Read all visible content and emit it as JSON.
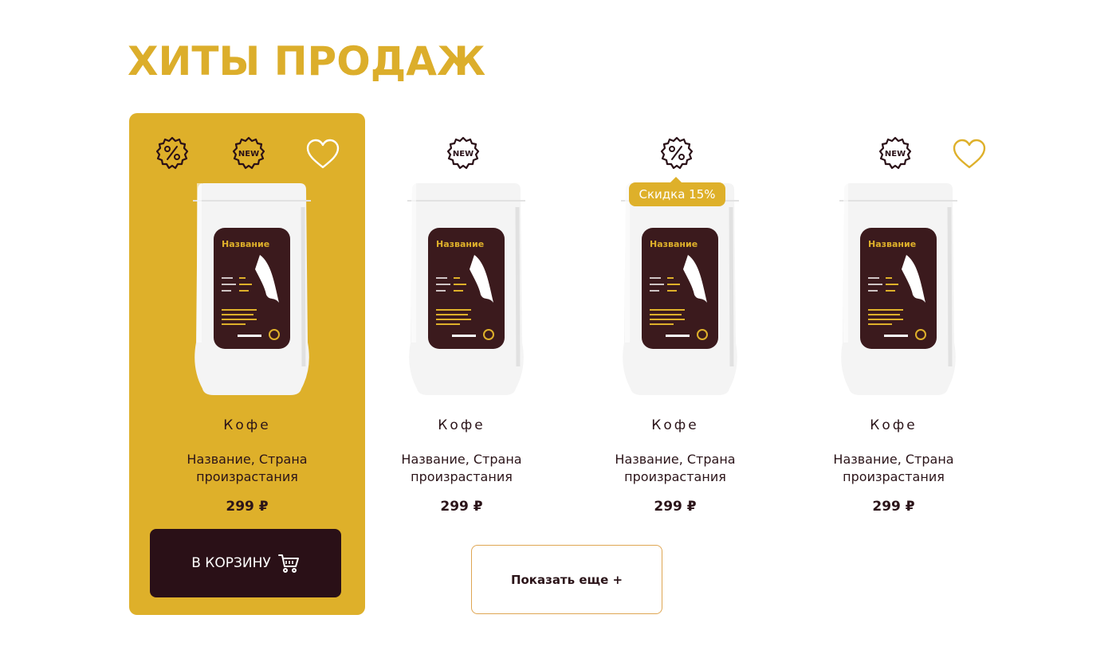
{
  "section": {
    "title": "ХИТЫ ПРОДАЖ"
  },
  "products": [
    {
      "name": "Кофе",
      "desc_line1": "Название, Страна",
      "desc_line2": "произрастания",
      "price": "299 ₽",
      "label_title": "Название",
      "badges": [
        "percent-badge",
        "new-badge",
        "heart"
      ]
    },
    {
      "name": "Кофе",
      "desc_line1": "Название, Страна",
      "desc_line2": "произрастания",
      "price": "299 ₽",
      "label_title": "Название",
      "badges": [
        "new-badge"
      ]
    },
    {
      "name": "Кофе",
      "desc_line1": "Название, Страна",
      "desc_line2": "произрастания",
      "price": "299 ₽",
      "label_title": "Название",
      "badges": [
        "percent-badge"
      ]
    },
    {
      "name": "Кофе",
      "desc_line1": "Название, Страна",
      "desc_line2": "произрастания",
      "price": "299 ₽",
      "label_title": "Название",
      "badges": [
        "new-badge",
        "heart"
      ]
    }
  ],
  "cart_button": {
    "label": "В КОРЗИНУ"
  },
  "discount_tooltip": {
    "text": "Скидка 15%"
  },
  "more_button": {
    "label": "Показать еще +"
  },
  "colors": {
    "accent": "#deb02a",
    "dark": "#2a1017",
    "text": "#2b1419",
    "outline": "#dfa653",
    "background": "#ffffff"
  }
}
